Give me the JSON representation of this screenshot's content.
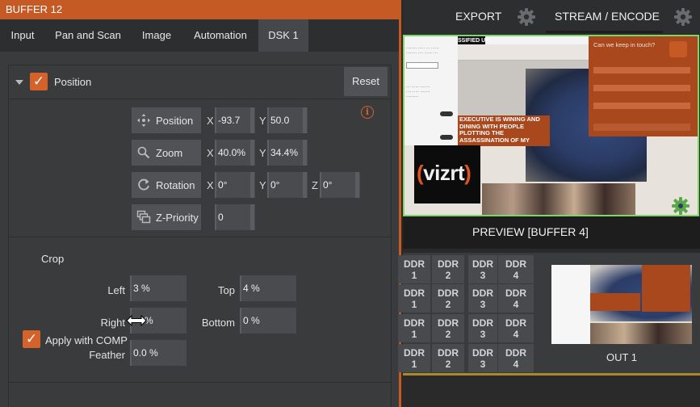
{
  "window": {
    "title": "BUFFER 12"
  },
  "tabs": [
    {
      "label": "Input",
      "active": false
    },
    {
      "label": "Pan and Scan",
      "active": false
    },
    {
      "label": "Image",
      "active": false
    },
    {
      "label": "Automation",
      "active": false
    },
    {
      "label": "DSK 1",
      "active": true
    }
  ],
  "position_section": {
    "label": "Position",
    "checked": true,
    "reset_label": "Reset",
    "rows": [
      {
        "label": "Position",
        "icon": "move-icon",
        "fields": [
          {
            "axis": "X",
            "value": "-93.7"
          },
          {
            "axis": "Y",
            "value": "50.0"
          }
        ]
      },
      {
        "label": "Zoom",
        "icon": "zoom-icon",
        "fields": [
          {
            "axis": "X",
            "value": "40.0%"
          },
          {
            "axis": "Y",
            "value": "34.4%"
          }
        ]
      },
      {
        "label": "Rotation",
        "icon": "rotate-icon",
        "fields": [
          {
            "axis": "X",
            "value": "0°"
          },
          {
            "axis": "Y",
            "value": "0°"
          },
          {
            "axis": "Z",
            "value": "0°"
          }
        ]
      },
      {
        "label": "Z-Priority",
        "icon": "layers-icon",
        "fields": [
          {
            "axis": "",
            "value": "0"
          }
        ]
      }
    ]
  },
  "crop": {
    "label": "Crop",
    "left_label": "Left",
    "left_value": "3 %",
    "top_label": "Top",
    "top_value": "4 %",
    "right_label": "Right",
    "right_value": "%",
    "bottom_label": "Bottom",
    "bottom_value": "0 %",
    "feather_label": "Feather",
    "feather_value": "0.0 %"
  },
  "apply_comp": {
    "label": "Apply with COMP",
    "checked": true
  },
  "topbar": {
    "export_label": "EXPORT",
    "stream_label": "STREAM / ENCODE"
  },
  "preview": {
    "label": "PREVIEW [BUFFER 4]",
    "headline": "EXECUTIVE IS WINING AND DINING WITH PEOPLE PLOTTING THE ASSASSINATION OF MY HUSBAND",
    "site_banner": "SSIFIED UK",
    "popup_title": "Can we keep in touch?",
    "logo_text": "vizrt"
  },
  "switcher": {
    "ddr_rows": [
      [
        "DDR 1",
        "DDR 2",
        "DDR 3",
        "DDR 4"
      ],
      [
        "DDR 1",
        "DDR 2",
        "DDR 3",
        "DDR 4"
      ],
      [
        "DDR 1",
        "DDR 2",
        "DDR 3",
        "DDR 4"
      ],
      [
        "DDR 1",
        "DDR 2",
        "DDR 3",
        "DDR 4"
      ]
    ],
    "out_label": "OUT 1"
  },
  "colors": {
    "accent": "#c55a24",
    "preview_border": "#7fd46a",
    "bus_line": "#a88a28"
  }
}
